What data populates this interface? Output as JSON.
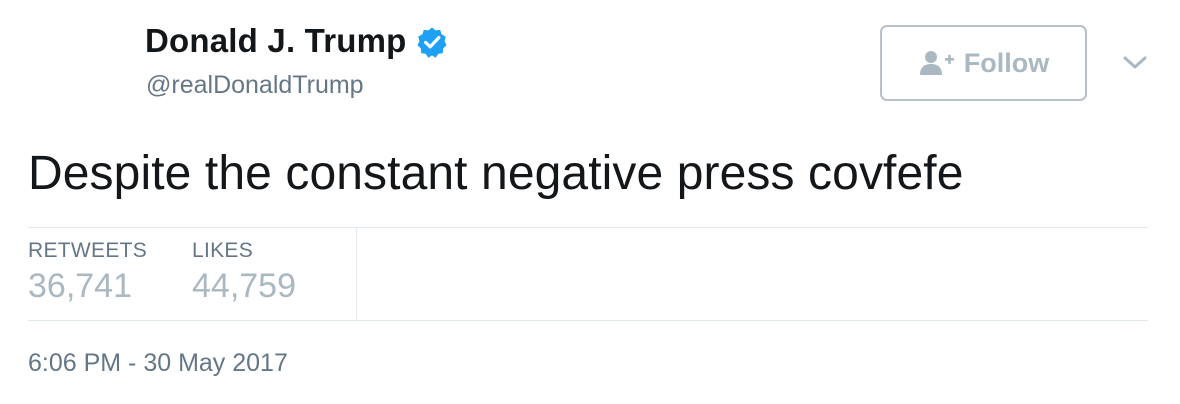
{
  "user": {
    "display_name": "Donald J. Trump",
    "handle": "@realDonaldTrump",
    "verified_icon": "verified-badge-icon"
  },
  "follow_button": {
    "label": "Follow",
    "icon": "follow-user-plus-icon"
  },
  "more_menu": {
    "icon": "chevron-down-icon"
  },
  "tweet": {
    "text": "Despite the constant negative press covfefe"
  },
  "stats": {
    "retweets": {
      "label": "RETWEETS",
      "value": "36,741"
    },
    "likes": {
      "label": "LIKES",
      "value": "44,759"
    }
  },
  "timestamp": "6:06 PM - 30 May 2017",
  "colors": {
    "text_primary": "#14171a",
    "text_secondary": "#657786",
    "text_muted": "#aab8c2",
    "verified_blue": "#1da1f2",
    "border": "#e1e8ed",
    "button_border": "#b8c0c8"
  }
}
